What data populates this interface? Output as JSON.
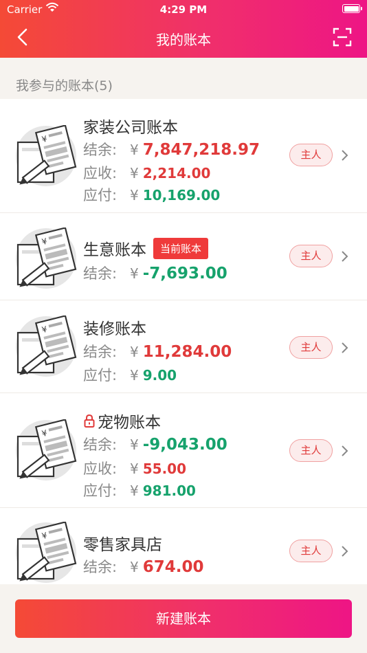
{
  "status_bar": {
    "carrier": "Carrier",
    "time": "4:29 PM"
  },
  "nav": {
    "title": "我的账本"
  },
  "section": {
    "label": "我参与的账本(5)"
  },
  "labels": {
    "balance": "结余:",
    "receivable": "应收:",
    "payable": "应付:",
    "currency": "¥",
    "owner": "主人"
  },
  "books": [
    {
      "name": "家装公司账本",
      "balance": "7,847,218.97",
      "receivable": "2,214.00",
      "payable": "10,169.00"
    },
    {
      "name": "生意账本",
      "badge": "当前账本",
      "balance": "-7,693.00"
    },
    {
      "name": "装修账本",
      "balance": "11,284.00",
      "payable": "9.00"
    },
    {
      "name": "宠物账本",
      "locked": true,
      "balance": "-9,043.00",
      "receivable": "55.00",
      "payable": "981.00"
    },
    {
      "name": "零售家具店",
      "balance": "674.00"
    }
  ],
  "new_button": {
    "label": "新建账本"
  },
  "colors": {
    "accent_start": "#f44a36",
    "accent_end": "#ee1585",
    "positive": "#e03a3a",
    "negative": "#16a26c"
  }
}
